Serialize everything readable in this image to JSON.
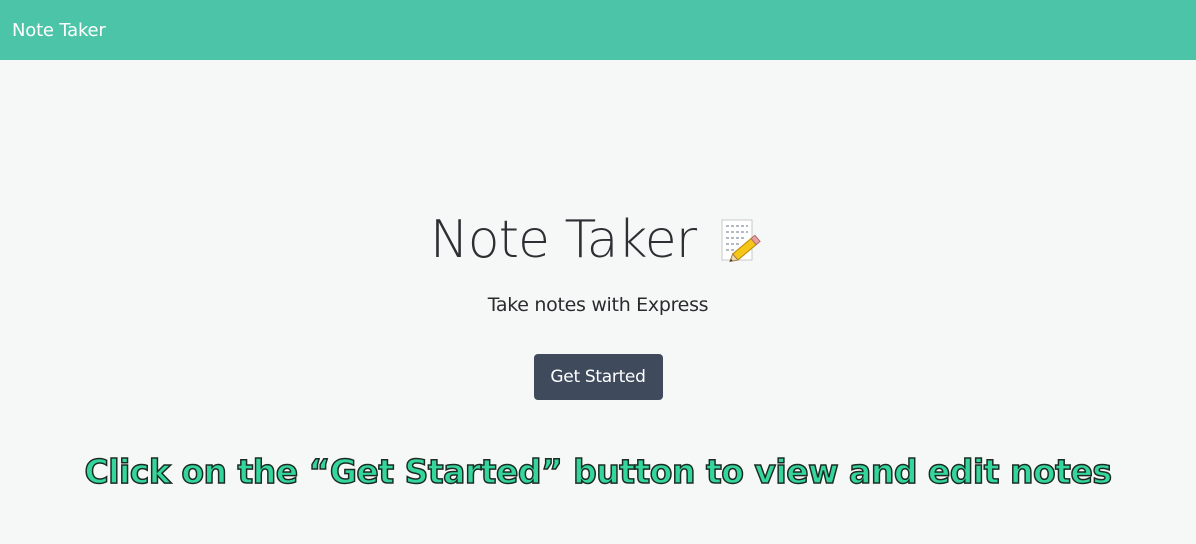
{
  "navbar": {
    "brand": "Note Taker"
  },
  "hero": {
    "title": "Note Taker",
    "icon": "memo-pencil-icon",
    "subtitle": "Take notes with Express",
    "button_label": "Get Started"
  },
  "caption": {
    "text": "Click on the “Get Started” button to view and edit notes"
  },
  "colors": {
    "navbar_bg": "#4bc4a8",
    "page_bg": "#f6f8f8",
    "button_bg": "#3f4a5c",
    "caption_fill": "#34d69b"
  }
}
